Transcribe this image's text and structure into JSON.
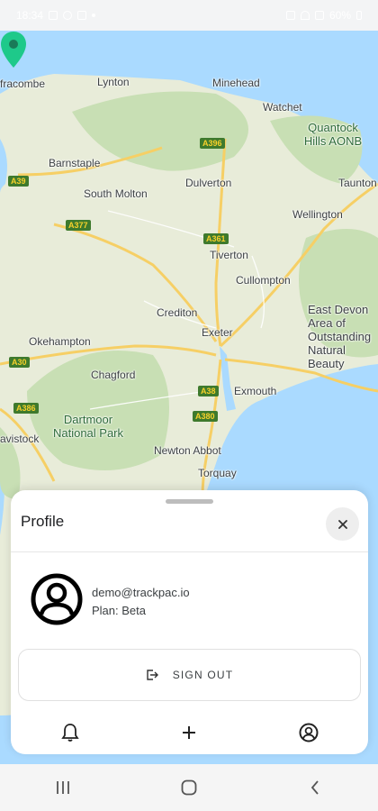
{
  "status_bar": {
    "time": "18:34",
    "battery": "60%"
  },
  "map": {
    "places": [
      {
        "name": "fracombe"
      },
      {
        "name": "Lynton"
      },
      {
        "name": "Minehead"
      },
      {
        "name": "Watchet"
      },
      {
        "name": "Quantock Hills AONB"
      },
      {
        "name": "Barnstaple"
      },
      {
        "name": "Taunton"
      },
      {
        "name": "South Molton"
      },
      {
        "name": "Dulverton"
      },
      {
        "name": "Wellington"
      },
      {
        "name": "Tiverton"
      },
      {
        "name": "Cullompton"
      },
      {
        "name": "Crediton"
      },
      {
        "name": "Exeter"
      },
      {
        "name": "East Devon Area of Outstanding Natural Beauty"
      },
      {
        "name": "Okehampton"
      },
      {
        "name": "Chagford"
      },
      {
        "name": "Exmouth"
      },
      {
        "name": "Dartmoor National Park"
      },
      {
        "name": "avistock"
      },
      {
        "name": "Newton Abbot"
      },
      {
        "name": "Torquay"
      }
    ],
    "roads": [
      "A396",
      "A39",
      "A377",
      "A361",
      "A30",
      "A38",
      "A386",
      "A380",
      "A386"
    ]
  },
  "profile": {
    "title": "Profile",
    "email": "demo@trackpac.io",
    "plan": "Plan: Beta",
    "signout_label": "SIGN OUT"
  },
  "icons": {
    "close": "close-icon",
    "avatar": "account-circle-icon",
    "signout": "logout-icon",
    "bell": "bell-icon",
    "add": "plus-icon",
    "account": "account-icon"
  },
  "colors": {
    "pin": "#1ec98a",
    "sea": "#aadaff",
    "land": "#e8ecd9",
    "park": "#c8dfb4"
  }
}
